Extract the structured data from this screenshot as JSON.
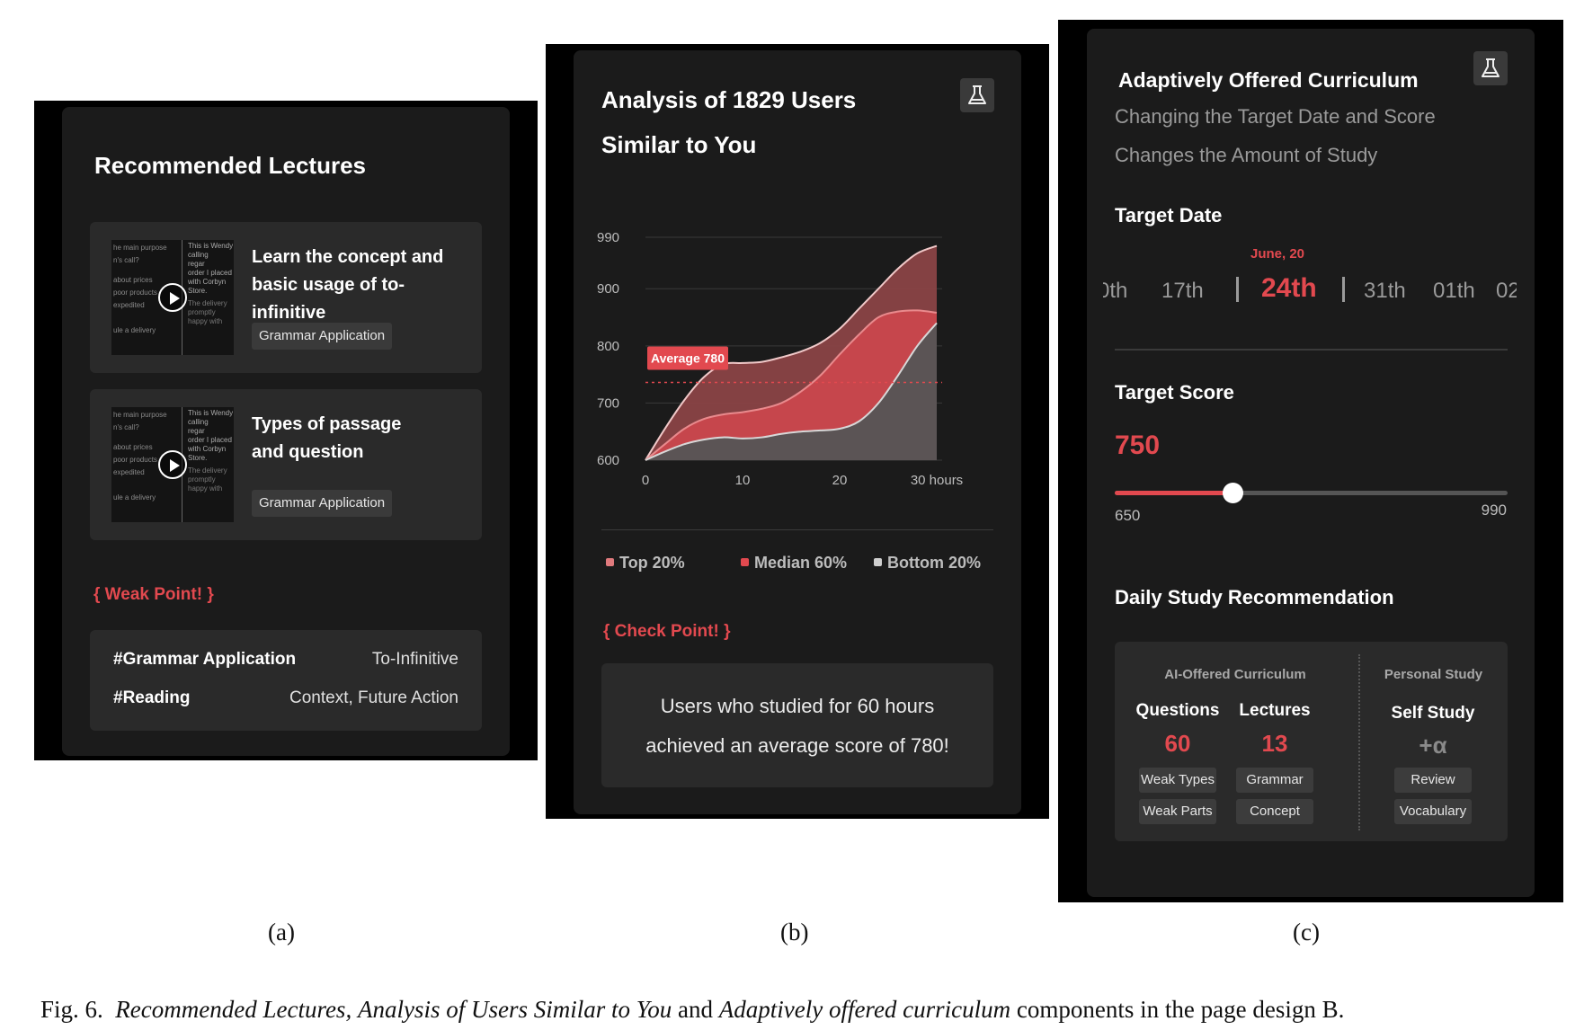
{
  "panel_a": {
    "title": "Recommended Lectures",
    "lectures": [
      {
        "title": "Learn the concept and basic usage of to-infinitive",
        "tag": "Grammar Application"
      },
      {
        "title": "Types of passage and question",
        "tag": "Grammar Application"
      }
    ],
    "thumb_text": {
      "left": [
        "he main purpose",
        "n's call?",
        "about prices",
        "poor products",
        "expedited",
        "",
        "ule a delivery"
      ],
      "right": [
        "This is Wendy",
        "calling",
        "regar",
        "order I placed",
        "with Corbyn",
        "Store.",
        "The delivery",
        "promptly",
        "happy with"
      ]
    },
    "weak_label": "{ Weak Point! }",
    "weak_rows": [
      {
        "tag": "#Grammar Application",
        "value": "To-Infinitive"
      },
      {
        "tag": "#Reading",
        "value": "Context, Future Action"
      }
    ],
    "caption": "(a)"
  },
  "panel_b": {
    "title_line1": "Analysis of 1829 Users",
    "title_line2": "Similar to You",
    "flask_icon": "flask-icon",
    "legend": [
      {
        "label": "Top 20%",
        "color": "#e07a7d"
      },
      {
        "label": "Median 60%",
        "color": "#e2494f"
      },
      {
        "label": "Bottom 20%",
        "color": "#cfcfcf"
      }
    ],
    "check_label": "{ Check Point! }",
    "check_text_line1": "Users who studied for 60 hours",
    "check_text_line2": "achieved an average score of 780!",
    "caption": "(b)"
  },
  "chart_data": {
    "type": "area",
    "title": "Analysis of 1829 Users Similar to You",
    "xlabel": "",
    "ylabel": "",
    "x_ticks": [
      "0",
      "10",
      "20",
      "30 hours"
    ],
    "y_ticks": [
      "990",
      "900",
      "800",
      "700",
      "600"
    ],
    "xlim": [
      0,
      30
    ],
    "ylim": [
      600,
      990
    ],
    "grid": true,
    "legend_position": "bottom",
    "annotation": {
      "label": "Average 780",
      "y": 780
    },
    "series": [
      {
        "name": "Top 20%",
        "color": "#8a4346",
        "x": [
          0,
          2,
          4,
          6,
          8,
          10,
          12,
          14,
          16,
          18,
          20,
          22,
          24,
          26,
          28,
          30
        ],
        "values": [
          600,
          655,
          705,
          745,
          768,
          770,
          772,
          780,
          790,
          805,
          830,
          865,
          900,
          935,
          962,
          975
        ]
      },
      {
        "name": "Median 60%",
        "color": "#c9474d",
        "x": [
          0,
          2,
          4,
          6,
          8,
          10,
          12,
          14,
          16,
          18,
          20,
          22,
          24,
          26,
          28,
          30
        ],
        "values": [
          600,
          628,
          655,
          672,
          680,
          684,
          690,
          700,
          720,
          748,
          785,
          820,
          850,
          860,
          862,
          858
        ]
      },
      {
        "name": "Bottom 20%",
        "color": "#555555",
        "x": [
          0,
          2,
          4,
          6,
          8,
          10,
          12,
          14,
          16,
          18,
          20,
          22,
          24,
          26,
          28,
          30
        ],
        "values": [
          600,
          615,
          628,
          636,
          640,
          638,
          640,
          646,
          650,
          652,
          655,
          668,
          700,
          748,
          800,
          840
        ]
      }
    ]
  },
  "panel_c": {
    "title": "Adaptively Offered Curriculum",
    "subtitle_line1": "Changing the Target Date and Score",
    "subtitle_line2": "Changes the Amount of Study",
    "flask_icon": "flask-icon",
    "target_date_label": "Target Date",
    "date_month": "June, 20",
    "dates": [
      "0th",
      "17th",
      "24th",
      "31th",
      "01th",
      "02"
    ],
    "selected_date": "24th",
    "target_score_label": "Target Score",
    "score": "750",
    "score_min": "650",
    "score_max": "990",
    "score_fraction": 0.3,
    "daily_label": "Daily Study Recommendation",
    "ai_header": "AI-Offered Curriculum",
    "personal_header": "Personal Study",
    "questions_label": "Questions",
    "questions_value": "60",
    "lectures_label": "Lectures",
    "lectures_value": "13",
    "self_study_label": "Self Study",
    "self_study_value": "+α",
    "question_chips": [
      "Weak Types",
      "Weak Parts"
    ],
    "lecture_chips": [
      "Grammar",
      "Concept"
    ],
    "personal_chips": [
      "Review",
      "Vocabulary"
    ],
    "caption": "(c)"
  },
  "figure_caption": {
    "prefix": "Fig. 6.",
    "part1": "Recommended Lectures,",
    "part2": "Analysis of Users Similar to You",
    "and": "and",
    "part3": "Adaptively offered curriculum",
    "suffix": "components in the page design B."
  }
}
